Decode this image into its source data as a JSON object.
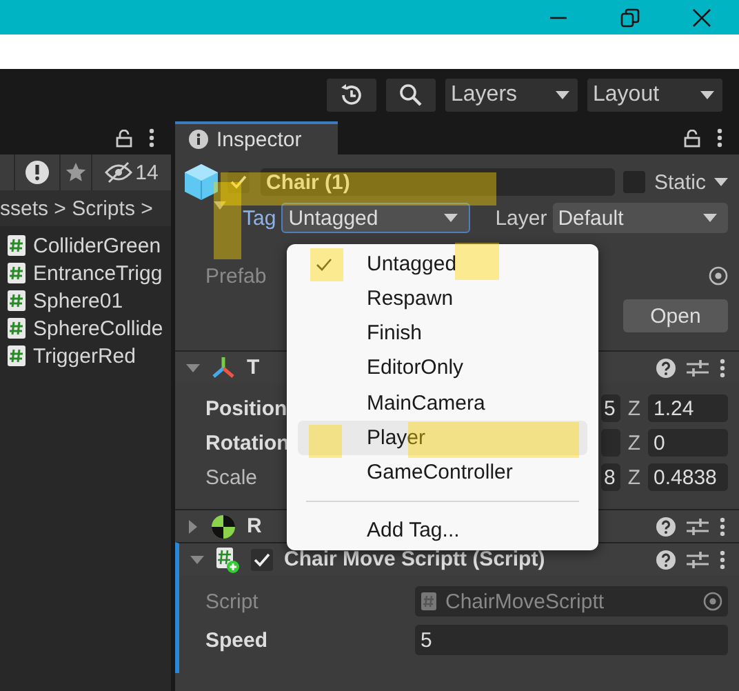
{
  "toolbar": {
    "dropdowns": [
      {
        "label": "Layers"
      },
      {
        "label": "Layout"
      }
    ]
  },
  "project_panel": {
    "hidden_count": "14",
    "breadcrumb": "ssets > Scripts >",
    "files": [
      {
        "name": "ColliderGreen"
      },
      {
        "name": "EntranceTrigg"
      },
      {
        "name": "Sphere01"
      },
      {
        "name": "SphereCollide"
      },
      {
        "name": "TriggerRed"
      }
    ]
  },
  "inspector": {
    "tab": "Inspector",
    "object": {
      "active": true,
      "name": "Chair (1)",
      "static": false,
      "static_label": "Static",
      "tag_label": "Tag",
      "tag": "Untagged",
      "layer_label": "Layer",
      "layer": "Default",
      "prefab_label": "Prefab",
      "open_button": "Open"
    },
    "components": [
      {
        "kind": "transform",
        "title": "T",
        "expanded": true,
        "rows": [
          {
            "label": "Position",
            "overridden": true,
            "x_value": "5",
            "z_label": "Z",
            "z_value": "1.24"
          },
          {
            "label": "Rotation",
            "overridden": true,
            "z_label": "Z",
            "z_value": "0"
          },
          {
            "label": "Scale",
            "overridden": false,
            "x_value": "8",
            "z_label": "Z",
            "z_value": "0.4838"
          }
        ]
      },
      {
        "kind": "rigidbody",
        "title": "R",
        "expanded": false
      },
      {
        "kind": "script",
        "title": "Chair Move Scriptt (Script)",
        "expanded": true,
        "enabled": true,
        "properties": [
          {
            "kind": "object",
            "label": "Script",
            "value": "ChairMoveScriptt"
          },
          {
            "kind": "number",
            "label": "Speed",
            "value": "5"
          }
        ]
      }
    ]
  },
  "tag_menu": {
    "items": [
      {
        "label": "Untagged",
        "selected": true,
        "hovered": false
      },
      {
        "label": "Respawn",
        "selected": false,
        "hovered": false
      },
      {
        "label": "Finish",
        "selected": false,
        "hovered": false
      },
      {
        "label": "EditorOnly",
        "selected": false,
        "hovered": false
      },
      {
        "label": "MainCamera",
        "selected": false,
        "hovered": false
      },
      {
        "label": "Player",
        "selected": false,
        "hovered": true
      },
      {
        "label": "GameController",
        "selected": false,
        "hovered": false
      }
    ],
    "add_tag": "Add Tag..."
  }
}
